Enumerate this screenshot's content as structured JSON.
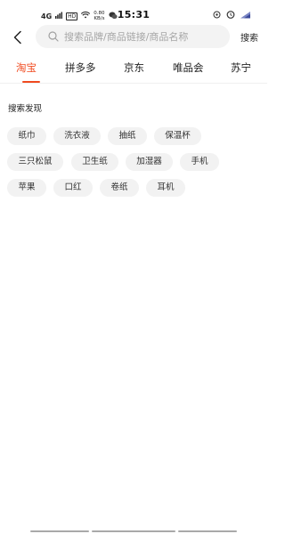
{
  "status_bar": {
    "network": "4G",
    "hd": "HD",
    "speed_value": "0.80",
    "speed_unit": "KB/s",
    "time": "15:31"
  },
  "header": {
    "search_placeholder": "搜索品牌/商品链接/商品名称",
    "search_button": "搜索"
  },
  "tabs": [
    {
      "label": "淘宝",
      "active": true
    },
    {
      "label": "拼多多",
      "active": false
    },
    {
      "label": "京东",
      "active": false
    },
    {
      "label": "唯品会",
      "active": false
    },
    {
      "label": "苏宁",
      "active": false
    }
  ],
  "discover": {
    "title": "搜索发现",
    "tags": [
      "纸巾",
      "洗衣液",
      "抽纸",
      "保温杯",
      "三只松鼠",
      "卫生纸",
      "加湿器",
      "手机",
      "苹果",
      "口红",
      "卷纸",
      "耳机"
    ]
  },
  "colors": {
    "accent": "#f04a1f",
    "tag_bg": "#f2f2f2",
    "search_bg": "#f3f3f3"
  }
}
